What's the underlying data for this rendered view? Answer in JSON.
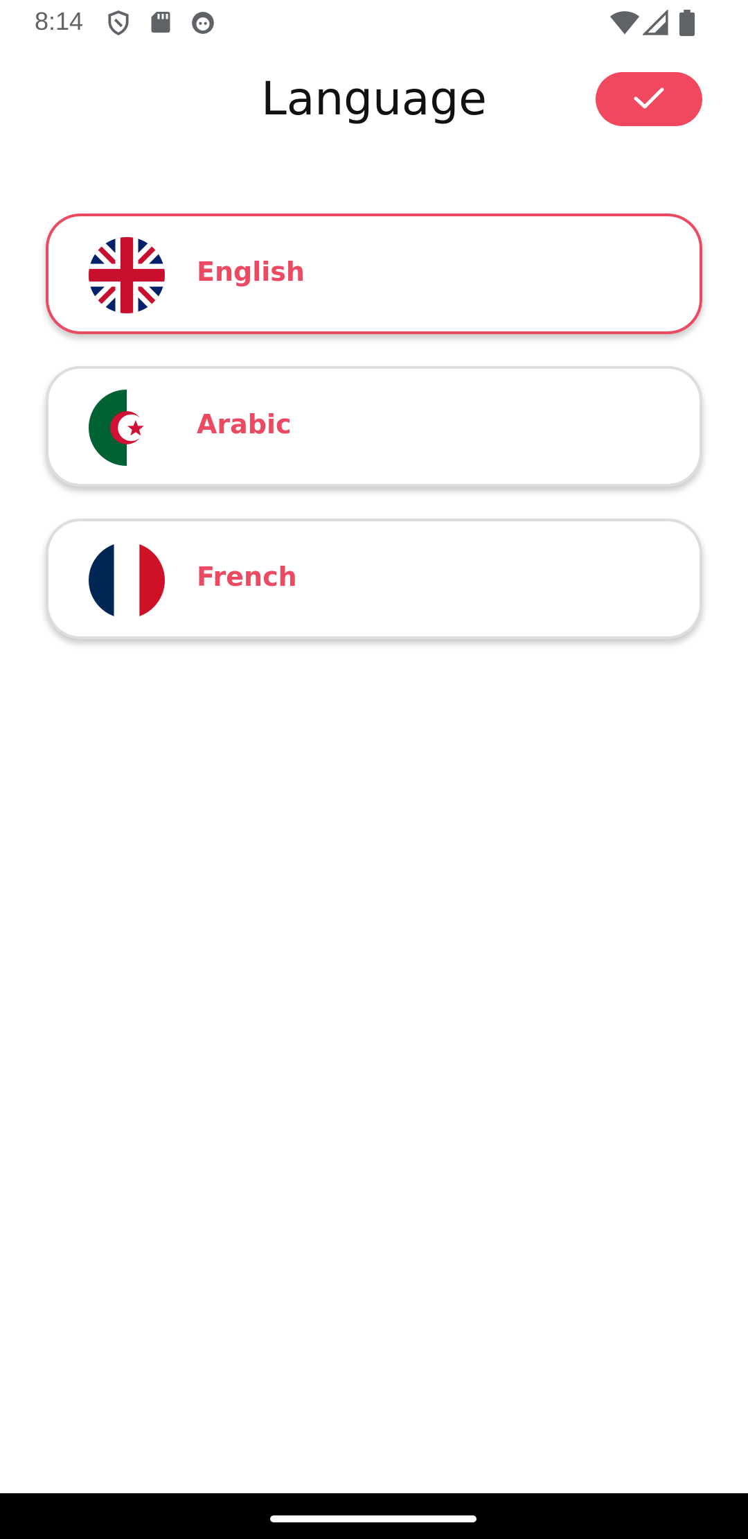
{
  "status_bar": {
    "time": "8:14",
    "left_icons": [
      "shield-icon",
      "sd-card-icon",
      "face-icon"
    ],
    "right_icons": [
      "wifi-icon",
      "signal-icon",
      "battery-icon"
    ]
  },
  "header": {
    "title": "Language",
    "confirm_icon": "check-icon"
  },
  "languages": [
    {
      "label": "English",
      "flag": "uk-flag-icon",
      "selected": true
    },
    {
      "label": "Arabic",
      "flag": "algeria-flag-icon",
      "selected": false
    },
    {
      "label": "French",
      "flag": "france-flag-icon",
      "selected": false
    }
  ],
  "colors": {
    "accent": "#f1485f",
    "label": "#ec4a62",
    "selected_border": "#ec4a62",
    "card_border": "#dddddd"
  }
}
